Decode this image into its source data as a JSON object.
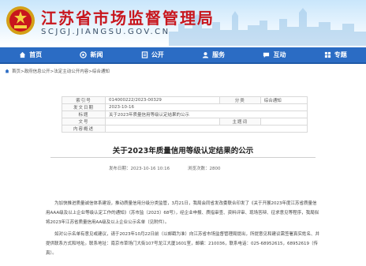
{
  "site": {
    "title": "江苏省市场监督管理局",
    "domain": "SCJGJ.JIANGSU.GOV.CN"
  },
  "nav": [
    {
      "label": "首页",
      "icon": "home-icon"
    },
    {
      "label": "新闻",
      "icon": "news-icon"
    },
    {
      "label": "公开",
      "icon": "open-info-icon"
    },
    {
      "label": "服务",
      "icon": "service-icon"
    },
    {
      "label": "互动",
      "icon": "interaction-icon"
    },
    {
      "label": "专题",
      "icon": "topic-icon"
    }
  ],
  "breadcrumb": "首页>政府信息公开>法定主动公开内容>综合通知",
  "info_table": {
    "index_label": "索引号",
    "index_value": "014000222/2023-00329",
    "category_label": "分类",
    "category_value": "综合通知",
    "issue_date_label": "发文日期",
    "issue_date_value": "2023-10-16",
    "title_label": "标题",
    "title_value": "关于2023年质量信用等级认定结果的公示",
    "doc_no_label": "文号",
    "doc_no_value": "",
    "theme_label": "主题词",
    "theme_value": "",
    "summary_label": "内容概述",
    "summary_value": ""
  },
  "document": {
    "title": "关于2023年质量信用等级认定结果的公示",
    "published_label": "发布日期：",
    "published_value": "2023-10-16 10:16",
    "views_label": "浏览次数：",
    "views_value": "2800",
    "paragraphs": [
      "为加快推进质量诚信体系建设，推动质量信用分级分类监管，3月21日，我局会同省发改委联合印发了《关于开展2023年度江苏省质量信用AAA级及以上企业等级认定工作的通知》（苏市监〔2023〕68号），经企业申报、质指审查、资料评审、现场答辩、征求意见等程序，我局拟将2023年江苏省质量信用AA级及以上企业公示名单（见附件）。",
      "如对公示名单有意见或建议，请于2023年10月22日前（以邮戳为准）向江苏省市场监督管理局提出，所提意见和建议需签署真实姓名、并提供联系方式和地址。联系地址：南京市草场门大街107号龙江大厦1601室，邮编：210036，联系电话：025-68952615，68952619（传真）。"
    ]
  },
  "colors": {
    "brand_red": "#c8161d",
    "nav_blue": "#2b6cc4"
  }
}
